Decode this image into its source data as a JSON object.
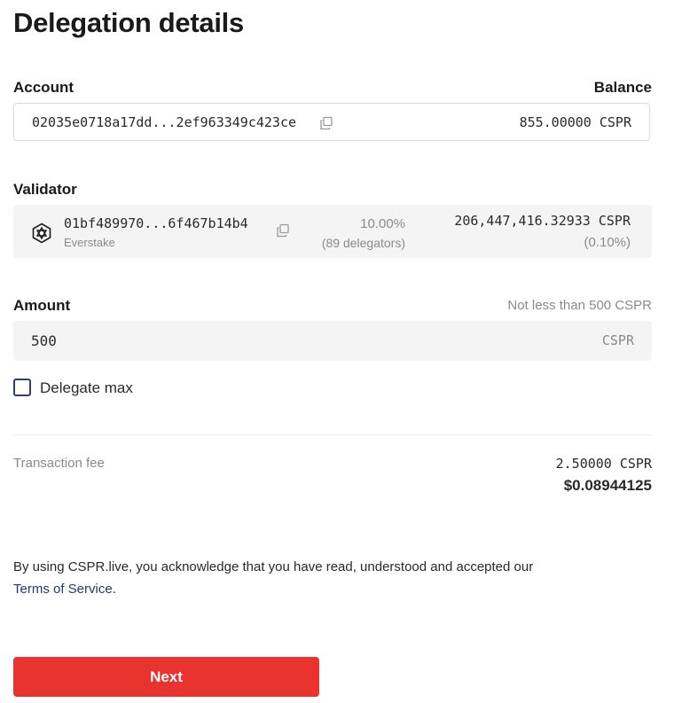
{
  "page": {
    "title": "Delegation details"
  },
  "account": {
    "label": "Account",
    "balance_label": "Balance",
    "hash": "02035e0718a17dd...2ef963349c423ce",
    "balance": "855.00000 CSPR",
    "copy_icon": "copy-icon"
  },
  "validator": {
    "label": "Validator",
    "hash": "01bf489970...6f467b14b4",
    "name": "Everstake",
    "fee": "10.00%",
    "delegators": "(89 delegators)",
    "stake": "206,447,416.32933 CSPR",
    "stake_share": "(0.10%)",
    "logo_icon": "everstake-logo-icon",
    "copy_icon": "copy-icon"
  },
  "amount": {
    "label": "Amount",
    "hint": "Not less than 500 CSPR",
    "value": "500",
    "unit": "CSPR"
  },
  "delegate_max": {
    "label": "Delegate max",
    "checked": false
  },
  "fee": {
    "label": "Transaction fee",
    "cspr": "2.50000 CSPR",
    "usd": "$0.08944125"
  },
  "terms": {
    "text": "By using CSPR.live, you acknowledge that you have read, understood and accepted our",
    "link_label": "Terms of Service",
    "suffix": "."
  },
  "actions": {
    "next_label": "Next"
  },
  "colors": {
    "primary_button": "#e8332f",
    "link": "#1f3a7a",
    "checkbox_border": "#2c3e6b",
    "muted_text": "#8a8a8a",
    "field_bg": "#f4f4f5"
  }
}
